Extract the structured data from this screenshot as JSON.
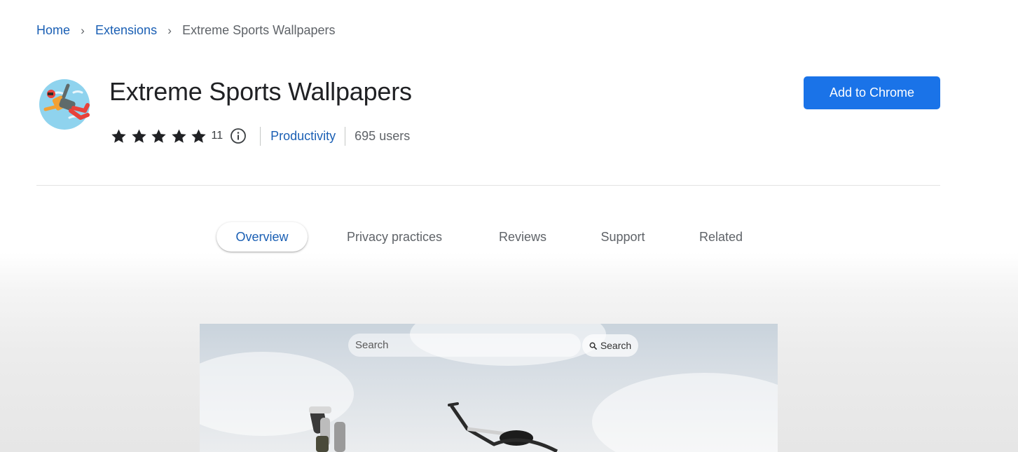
{
  "breadcrumb": {
    "home": "Home",
    "extensions": "Extensions",
    "current": "Extreme Sports Wallpapers",
    "separator": "›"
  },
  "extension": {
    "title": "Extreme Sports Wallpapers",
    "rating": 5,
    "rating_count": "11",
    "category": "Productivity",
    "users": "695 users",
    "icon": "skydiver-icon"
  },
  "actions": {
    "add_label": "Add to Chrome"
  },
  "tabs": [
    {
      "label": "Overview",
      "active": true
    },
    {
      "label": "Privacy practices",
      "active": false
    },
    {
      "label": "Reviews",
      "active": false
    },
    {
      "label": "Support",
      "active": false
    },
    {
      "label": "Related",
      "active": false
    }
  ],
  "preview": {
    "search_placeholder": "Search",
    "search_button": "Search"
  },
  "colors": {
    "accent": "#1a73e8",
    "link": "#1a5fb4",
    "text": "#202124",
    "muted": "#5f6368"
  }
}
